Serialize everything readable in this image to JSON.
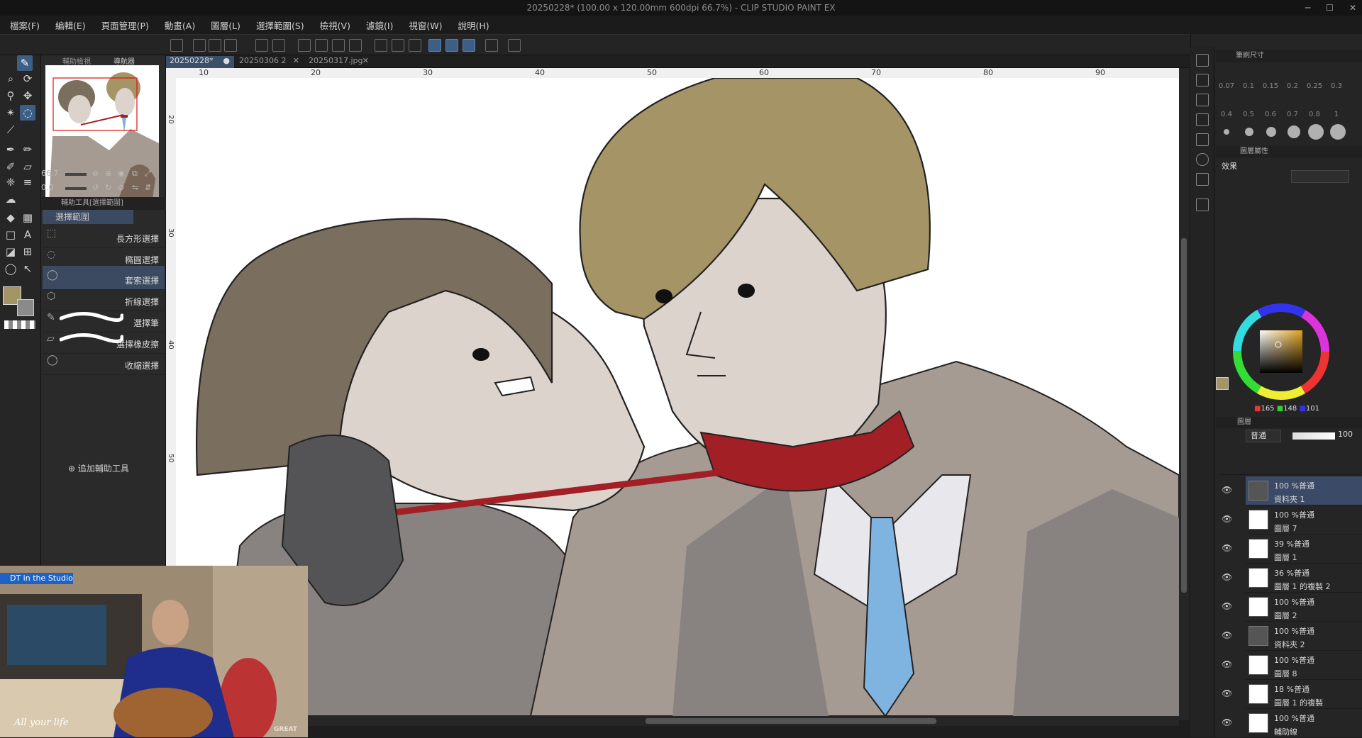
{
  "titlebar": {
    "title": "20250228* (100.00 x 120.00mm 600dpi 66.7%) - CLIP STUDIO PAINT EX",
    "minimize": "─",
    "maximize": "☐",
    "close": "✕"
  },
  "menu": [
    "檔案(F)",
    "編輯(E)",
    "頁面管理(P)",
    "動畫(A)",
    "圖層(L)",
    "選擇範圍(S)",
    "檢視(V)",
    "濾鏡(I)",
    "視窗(W)",
    "說明(H)"
  ],
  "doc_tabs": [
    {
      "label": "20250228*",
      "active": true
    },
    {
      "label": "20250306 2",
      "active": false
    },
    {
      "label": "20250317.jpg",
      "active": false
    }
  ],
  "ruler_ticks": [
    "10",
    "20",
    "30",
    "40",
    "50",
    "60",
    "70",
    "80",
    "90"
  ],
  "ruler_left_ticks": [
    "20",
    "30",
    "40",
    "50"
  ],
  "navigator": {
    "tab_sub": "輔助檢視",
    "tab_nav": "導航器",
    "zoom": "66.7",
    "rotate": "0.0"
  },
  "subtool_panel": {
    "title": "輔助工具[選擇範圍]",
    "group": "選擇範圍",
    "add_label": "追加輔助工具",
    "items": [
      {
        "label": "長方形選擇",
        "selected": false
      },
      {
        "label": "橢圓選擇",
        "selected": false
      },
      {
        "label": "套索選擇",
        "selected": true
      },
      {
        "label": "折線選擇",
        "selected": false
      },
      {
        "label": "選擇筆",
        "selected": false
      },
      {
        "label": "選擇橡皮擦",
        "selected": false
      },
      {
        "label": "收縮選擇",
        "selected": false
      }
    ]
  },
  "brush_size": {
    "title": "筆刷尺寸",
    "sizes": [
      "0.07",
      "0.1",
      "0.15",
      "0.2",
      "0.25",
      "0.3",
      "0.4",
      "0.5",
      "0.6",
      "0.7",
      "0.8",
      "1"
    ]
  },
  "layer_property": {
    "title": "圖層屬性",
    "effect_label": "效果"
  },
  "color": {
    "main": "#a59465",
    "r": "165",
    "g": "148",
    "b": "101"
  },
  "layer_panel": {
    "title": "圖層",
    "blend": "普通",
    "opacity": "100",
    "layers": [
      {
        "blend": "100 %普通",
        "name": "資料夾 1",
        "selected": true,
        "folder": true
      },
      {
        "blend": "100 %普通",
        "name": "圖層 7"
      },
      {
        "blend": "39 %普通",
        "name": "圖層 1"
      },
      {
        "blend": "36 %普通",
        "name": "圖層 1 的複製 2"
      },
      {
        "blend": "100 %普通",
        "name": "圖層 2"
      },
      {
        "blend": "100 %普通",
        "name": "資料夾 2",
        "folder": true
      },
      {
        "blend": "100 %普通",
        "name": "圖層 8"
      },
      {
        "blend": "18 %普通",
        "name": "圖層 1 的複製"
      },
      {
        "blend": "100 %普通",
        "name": "輔助線"
      }
    ]
  },
  "webcam": {
    "badge": "DT in the Studio",
    "caption": "All your life",
    "watermark": "GREAT"
  },
  "colors": {
    "hair_left": "#7a6e5e",
    "hair_right": "#a59465",
    "skin": "#ddd3cd",
    "suit": "#a59b93",
    "suit_dark": "#888380",
    "glove": "#545456",
    "collar": "#a11f25",
    "tie": "#7fb4e0",
    "shirt": "#e8e8ec"
  }
}
